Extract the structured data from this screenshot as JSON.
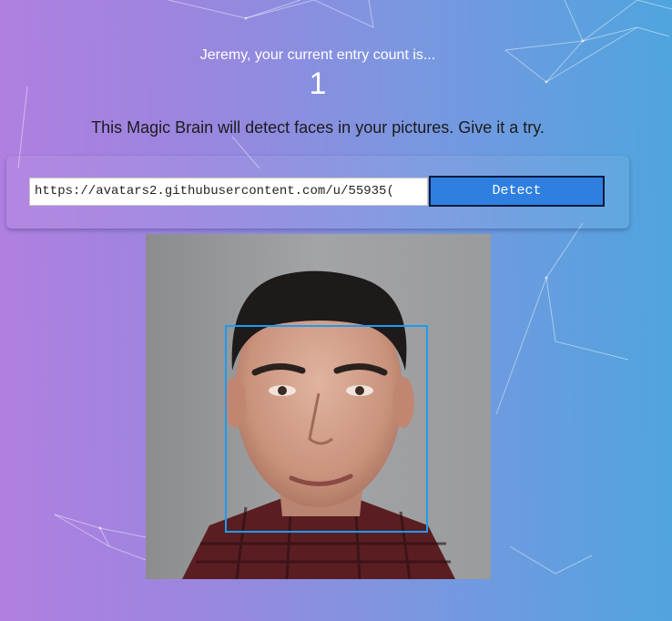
{
  "rank": {
    "text": "Jeremy, your current entry count is...",
    "count": "1"
  },
  "instructions": "This Magic Brain will detect faces in your pictures. Give it a try.",
  "form": {
    "url_value": "https://avatars2.githubusercontent.com/u/55935(",
    "detect_label": "Detect"
  },
  "image": {
    "description_icon": "face-photo"
  },
  "colors": {
    "bg_left": "#b17fe0",
    "bg_right": "#4fa5de",
    "button": "#2f7fe0",
    "face_box": "#1d9bf0"
  }
}
